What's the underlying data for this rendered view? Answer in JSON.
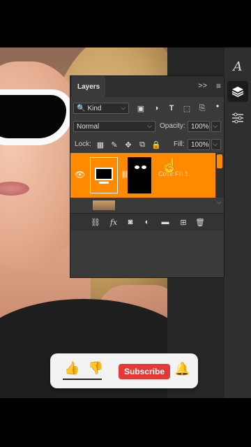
{
  "panel": {
    "title": "Layers",
    "expand_icon": ">>",
    "menu_icon": "≡",
    "filter": {
      "selected": "Kind"
    },
    "blend": {
      "mode": "Normal",
      "opacity_label": "Opacity:",
      "opacity_value": "100%"
    },
    "lock": {
      "label": "Lock:",
      "fill_label": "Fill:",
      "fill_value": "100%"
    },
    "layers": [
      {
        "name": "Color Fill 1",
        "selected": true
      },
      {
        "name": "",
        "selected": false
      }
    ]
  },
  "tools": [
    "type-icon",
    "layers-icon",
    "adjustments-icon"
  ],
  "subscribe_bar": {
    "button_label": "Subscribe"
  },
  "colors": {
    "accent": "#ff8a00",
    "subscribe": "#e53935",
    "panel_bg": "#3a3a3a"
  }
}
